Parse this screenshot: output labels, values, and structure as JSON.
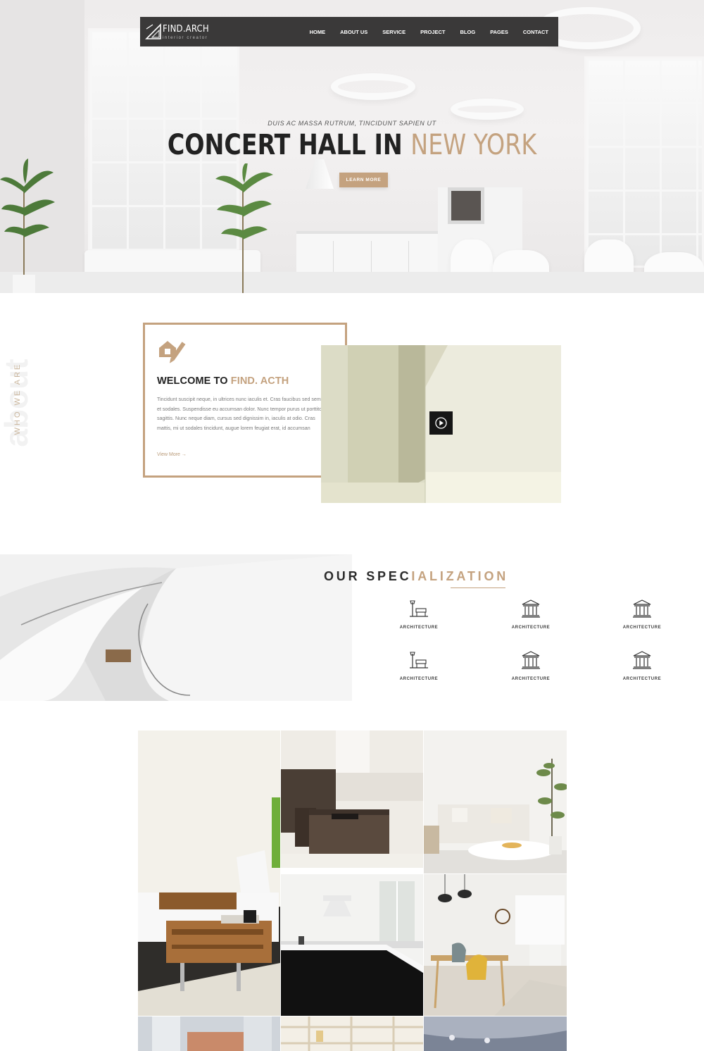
{
  "nav": {
    "brand": "FIND.ARCH",
    "tagline": "interior creator",
    "items": [
      "HOME",
      "ABOUT US",
      "SERVICE",
      "PROJECT",
      "BLOG",
      "PAGES",
      "CONTACT"
    ]
  },
  "hero": {
    "subtitle": "DUIS AC MASSA RUTRUM, TINCIDUNT SAPIEN UT",
    "title_main": "CONCERT HALL IN ",
    "title_accent": "NEW YORK",
    "button": "LEARN MORE"
  },
  "about": {
    "side_label": "WHO WE ARE",
    "side_watermark": "about",
    "heading_main": "WELCOME TO ",
    "heading_accent": "FIND. ACTH",
    "body": "Tincidunt suscipit neque, in ultrices nunc iaculis et. Cras faucibus sed sem et sodales. Suspendisse eu accumsan dolor. Nunc tempor purus ut porttitor sagittis. Nunc neque diam, cursus sed dignissim in, iaculis at odio. Cras mattis, mi ut sodales tincidunt, augue lorem feugiat erat, id accumsan",
    "link": "View More →"
  },
  "specialization": {
    "title_main": "OUR SPEC",
    "title_accent": "IALIZATION",
    "items": [
      {
        "label": "ARCHITECTURE",
        "icon": "street-lamp-bench-icon"
      },
      {
        "label": "ARCHITECTURE",
        "icon": "classical-building-icon"
      },
      {
        "label": "ARCHITECTURE",
        "icon": "classical-building-icon"
      },
      {
        "label": "ARCHITECTURE",
        "icon": "street-lamp-bench-icon"
      },
      {
        "label": "ARCHITECTURE",
        "icon": "classical-building-icon"
      },
      {
        "label": "ARCHITECTURE",
        "icon": "classical-building-icon"
      }
    ]
  },
  "colors": {
    "accent": "#c4a27f",
    "nav_bg": "#3a3939",
    "dark_text": "#222222"
  }
}
